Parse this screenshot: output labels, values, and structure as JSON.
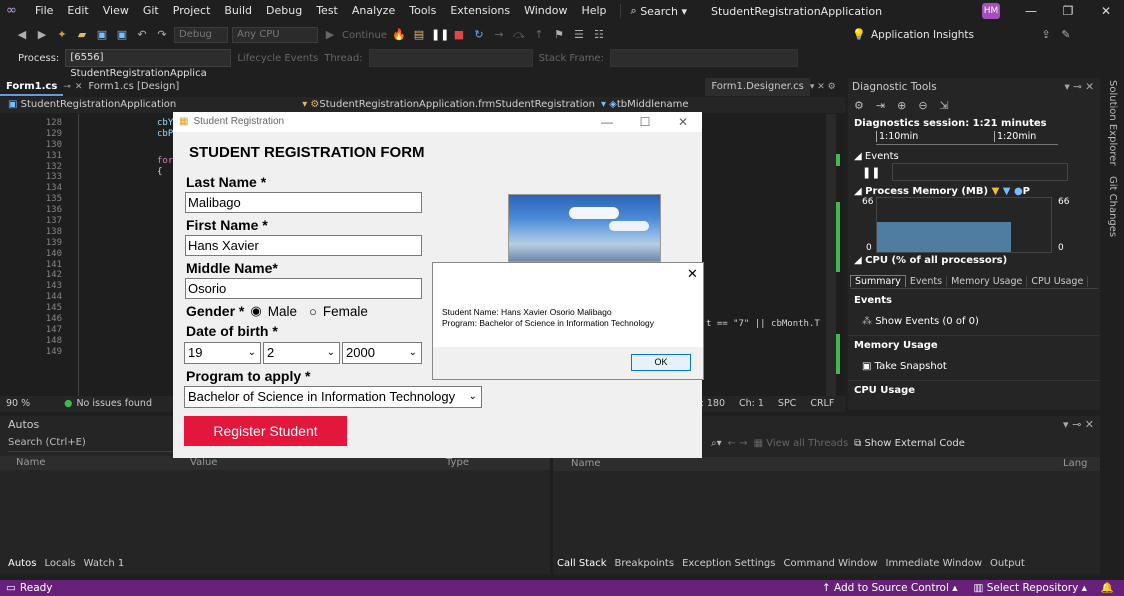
{
  "menu": {
    "items": [
      "File",
      "Edit",
      "View",
      "Git",
      "Project",
      "Build",
      "Debug",
      "Test",
      "Analyze",
      "Tools",
      "Extensions",
      "Window",
      "Help"
    ],
    "search": "Search",
    "app_title": "StudentRegistrationApplication",
    "avatar": "HM"
  },
  "toolbar": {
    "config": "Debug",
    "platform": "Any CPU",
    "continue": "Continue",
    "insights": "Application Insights"
  },
  "debugbar": {
    "process_label": "Process:",
    "process_value": "[6556] StudentRegistrationApplica",
    "lifecycle": "Lifecycle Events",
    "thread_label": "Thread:",
    "stackframe_label": "Stack Frame:"
  },
  "editor": {
    "tabs": [
      "Form1.cs",
      "Form1.cs [Design]",
      "Form1.Designer.cs"
    ],
    "nav_project": "StudentRegistrationApplication",
    "nav_class": "StudentRegistrationApplication.frmStudentRegistration",
    "nav_member": "tbMiddlename",
    "line_numbers": [
      "128",
      "129",
      "130",
      "131",
      "132",
      "133",
      "134",
      "135",
      "136",
      "137",
      "138",
      "139",
      "140",
      "141",
      "142",
      "143",
      "144",
      "145",
      "146",
      "147",
      "148",
      "149"
    ],
    "code_snippets": {
      "l128": "cbY",
      "l129": "cbP",
      "l131": "for",
      "l132": "{",
      "l143": "t == \"7\" || cbMonth.T"
    },
    "zoom": "90 %",
    "issues": "No issues found",
    "ln": "ln: 180",
    "ch": "Ch: 1",
    "spc": "SPC",
    "crlf": "CRLF"
  },
  "diagnostics": {
    "title": "Diagnostic Tools",
    "session": "Diagnostics session: 1:21 minutes",
    "ticks": [
      "1:10min",
      "1:20min"
    ],
    "events_label": "Events",
    "memory_label": "Process Memory (MB)",
    "memory_legend_p": "P",
    "mem_max_left": "66",
    "mem_max_right": "66",
    "mem_min_left": "0",
    "mem_min_right": "0",
    "memory_fill": 0.55,
    "cpu_label": "CPU (% of all processors)",
    "tabs": [
      "Summary",
      "Events",
      "Memory Usage",
      "CPU Usage"
    ],
    "sec_events": "Events",
    "show_events": "Show Events (0 of 0)",
    "sec_memory": "Memory Usage",
    "take_snapshot": "Take Snapshot",
    "sec_cpu": "CPU Usage",
    "side_tabs": [
      "Solution Explorer",
      "Git Changes"
    ]
  },
  "autos": {
    "title": "Autos",
    "search_placeholder": "Search (Ctrl+E)",
    "cols": [
      "Name",
      "Value",
      "Type"
    ],
    "bottom_tabs": [
      "Autos",
      "Locals",
      "Watch 1"
    ]
  },
  "callstack": {
    "view_threads": "View all Threads",
    "show_external": "Show External Code",
    "col_name": "Name",
    "col_lang": "Lang",
    "bottom_tabs": [
      "Call Stack",
      "Breakpoints",
      "Exception Settings",
      "Command Window",
      "Immediate Window",
      "Output"
    ]
  },
  "status": {
    "ready": "Ready",
    "add_source": "Add to Source Control",
    "select_repo": "Select Repository"
  },
  "form": {
    "window_title": "Student Registration",
    "heading": "STUDENT REGISTRATION FORM",
    "last_name_label": "Last Name *",
    "last_name": "Malibago",
    "first_name_label": "First Name *",
    "first_name": "Hans Xavier",
    "middle_name_label": "Middle Name*",
    "middle_name": "Osorio",
    "gender_label": "Gender *",
    "male": "Male",
    "female": "Female",
    "dob_label": "Date of birth *",
    "day": "19",
    "month": "2",
    "year": "2000",
    "program_label": "Program to apply *",
    "program": "Bachelor of Science in Information Technology",
    "register_button": "Register Student",
    "accent": "#e3173b"
  },
  "dialog": {
    "line1": "Student Name: Hans Xavier Osorio Malibago",
    "line2": "Program: Bachelor of Science in Information Technology",
    "ok": "OK"
  }
}
